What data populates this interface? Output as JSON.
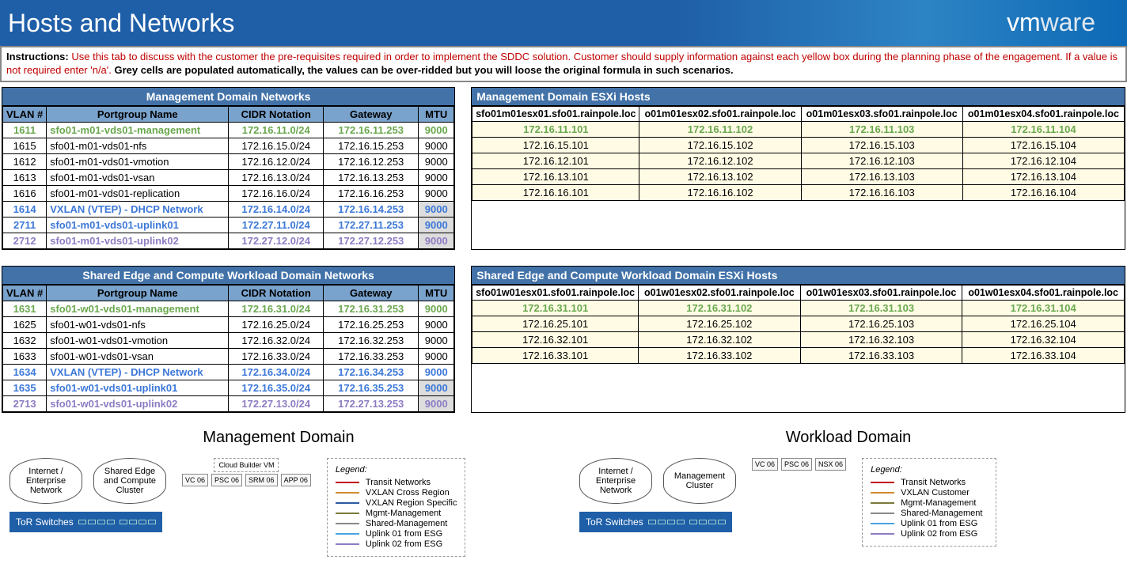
{
  "banner": {
    "title": "Hosts and Networks",
    "logo1": "vm",
    "logo2": "ware"
  },
  "instructions": {
    "label": "Instructions:",
    "red": " Use this tab to discuss with the customer the pre-requisites required in order to implement the SDDC solution. Customer should supply information against each yellow box during the planning phase of the engagement.  If a value is not required enter 'n/a'.  ",
    "black": "Grey cells are populated automatically, the values can be over-ridded but you will loose the original formula in such scenarios."
  },
  "mgmt_net": {
    "title": "Management Domain Networks",
    "headers": [
      "VLAN #",
      "Portgroup Name",
      "CIDR Notation",
      "Gateway",
      "MTU"
    ],
    "rows": [
      {
        "vlan": "1611",
        "pg": "sfo01-m01-vds01-management",
        "cidr": "172.16.11.0/24",
        "gw": "172.16.11.253",
        "mtu": "9000",
        "cls": "gr"
      },
      {
        "vlan": "1615",
        "pg": "sfo01-m01-vds01-nfs",
        "cidr": "172.16.15.0/24",
        "gw": "172.16.15.253",
        "mtu": "9000",
        "cls": ""
      },
      {
        "vlan": "1612",
        "pg": "sfo01-m01-vds01-vmotion",
        "cidr": "172.16.12.0/24",
        "gw": "172.16.12.253",
        "mtu": "9000",
        "cls": ""
      },
      {
        "vlan": "1613",
        "pg": "sfo01-m01-vds01-vsan",
        "cidr": "172.16.13.0/24",
        "gw": "172.16.13.253",
        "mtu": "9000",
        "cls": ""
      },
      {
        "vlan": "1616",
        "pg": "sfo01-m01-vds01-replication",
        "cidr": "172.16.16.0/24",
        "gw": "172.16.16.253",
        "mtu": "9000",
        "cls": ""
      },
      {
        "vlan": "1614",
        "pg": "VXLAN (VTEP) - DHCP Network",
        "cidr": "172.16.14.0/24",
        "gw": "172.16.14.253",
        "mtu": "9000",
        "cls": "bl",
        "greyMtu": true
      },
      {
        "vlan": "2711",
        "pg": "sfo01-m01-vds01-uplink01",
        "cidr": "172.27.11.0/24",
        "gw": "172.27.11.253",
        "mtu": "9000",
        "cls": "bl",
        "greyMtu": true
      },
      {
        "vlan": "2712",
        "pg": "sfo01-m01-vds01-uplink02",
        "cidr": "172.27.12.0/24",
        "gw": "172.27.12.253",
        "mtu": "9000",
        "cls": "pu",
        "greyMtu": true
      }
    ]
  },
  "mgmt_hosts": {
    "title": "Management Domain ESXi Hosts",
    "headers": [
      "sfo01m01esx01.sfo01.rainpole.loc",
      "o01m01esx02.sfo01.rainpole.loc",
      "o01m01esx03.sfo01.rainpole.loc",
      "o01m01esx04.sfo01.rainpole.loc"
    ],
    "rows": [
      {
        "cells": [
          "172.16.11.101",
          "172.16.11.102",
          "172.16.11.103",
          "172.16.11.104"
        ],
        "cls": "gr",
        "yellow": true
      },
      {
        "cells": [
          "172.16.15.101",
          "172.16.15.102",
          "172.16.15.103",
          "172.16.15.104"
        ],
        "cls": "",
        "yellow": true
      },
      {
        "cells": [
          "172.16.12.101",
          "172.16.12.102",
          "172.16.12.103",
          "172.16.12.104"
        ],
        "cls": "",
        "yellow": true
      },
      {
        "cells": [
          "172.16.13.101",
          "172.16.13.102",
          "172.16.13.103",
          "172.16.13.104"
        ],
        "cls": "",
        "yellow": true
      },
      {
        "cells": [
          "172.16.16.101",
          "172.16.16.102",
          "172.16.16.103",
          "172.16.16.104"
        ],
        "cls": "",
        "yellow": true
      }
    ]
  },
  "wl_net": {
    "title": "Shared Edge and Compute Workload Domain Networks",
    "headers": [
      "VLAN #",
      "Portgroup Name",
      "CIDR Notation",
      "Gateway",
      "MTU"
    ],
    "rows": [
      {
        "vlan": "1631",
        "pg": "sfo01-w01-vds01-management",
        "cidr": "172.16.31.0/24",
        "gw": "172.16.31.253",
        "mtu": "9000",
        "cls": "gr"
      },
      {
        "vlan": "1625",
        "pg": "sfo01-w01-vds01-nfs",
        "cidr": "172.16.25.0/24",
        "gw": "172.16.25.253",
        "mtu": "9000",
        "cls": ""
      },
      {
        "vlan": "1632",
        "pg": "sfo01-w01-vds01-vmotion",
        "cidr": "172.16.32.0/24",
        "gw": "172.16.32.253",
        "mtu": "9000",
        "cls": ""
      },
      {
        "vlan": "1633",
        "pg": "sfo01-w01-vds01-vsan",
        "cidr": "172.16.33.0/24",
        "gw": "172.16.33.253",
        "mtu": "9000",
        "cls": ""
      },
      {
        "vlan": "1634",
        "pg": "VXLAN (VTEP) - DHCP Network",
        "cidr": "172.16.34.0/24",
        "gw": "172.16.34.253",
        "mtu": "9000",
        "cls": "bl"
      },
      {
        "vlan": "1635",
        "pg": "sfo01-w01-vds01-uplink01",
        "cidr": "172.16.35.0/24",
        "gw": "172.16.35.253",
        "mtu": "9000",
        "cls": "bl",
        "greyMtu": true
      },
      {
        "vlan": "2713",
        "pg": "sfo01-w01-vds01-uplink02",
        "cidr": "172.27.13.0/24",
        "gw": "172.27.13.253",
        "mtu": "9000",
        "cls": "pu",
        "greyMtu": true
      }
    ]
  },
  "wl_hosts": {
    "title": "Shared Edge and Compute Workload Domain ESXi Hosts",
    "headers": [
      "sfo01w01esx01.sfo01.rainpole.loc",
      "o01w01esx02.sfo01.rainpole.loc",
      "o01w01esx03.sfo01.rainpole.loc",
      "o01w01esx04.sfo01.rainpole.loc"
    ],
    "rows": [
      {
        "cells": [
          "172.16.31.101",
          "172.16.31.102",
          "172.16.31.103",
          "172.16.31.104"
        ],
        "cls": "gr",
        "yellow": true
      },
      {
        "cells": [
          "172.16.25.101",
          "172.16.25.102",
          "172.16.25.103",
          "172.16.25.104"
        ],
        "cls": "",
        "yellow": true
      },
      {
        "cells": [
          "172.16.32.101",
          "172.16.32.102",
          "172.16.32.103",
          "172.16.32.104"
        ],
        "cls": "",
        "yellow": true
      },
      {
        "cells": [
          "172.16.33.101",
          "172.16.33.102",
          "172.16.33.103",
          "172.16.33.104"
        ],
        "cls": "",
        "yellow": true
      }
    ]
  },
  "diag": {
    "mgmt": {
      "title": "Management Domain",
      "cloud1": "Internet / Enterprise Network",
      "cloud2": "Shared Edge and Compute Cluster",
      "cbvm": "Cloud Builder VM",
      "comps": [
        "VC 06",
        "PSC 06",
        "SRM 06",
        "APP 06"
      ],
      "tor": "ToR Switches",
      "legend_title": "Legend:",
      "legend": [
        {
          "c": "lt-red",
          "t": "Transit Networks"
        },
        {
          "c": "lt-orange",
          "t": "VXLAN Cross Region"
        },
        {
          "c": "lt-blue",
          "t": "VXLAN Region Specific"
        },
        {
          "c": "lt-olive",
          "t": "Mgmt-Management"
        },
        {
          "c": "lt-grey",
          "t": "Shared-Management"
        },
        {
          "c": "lt-sky",
          "t": "Uplink 01 from ESG"
        },
        {
          "c": "lt-pu",
          "t": "Uplink 02 from ESG"
        }
      ]
    },
    "wl": {
      "title": "Workload Domain",
      "cloud1": "Internet / Enterprise Network",
      "cloud2": "Management Cluster",
      "comps": [
        "VC 06",
        "PSC 06",
        "NSX 06"
      ],
      "tor": "ToR Switches",
      "legend_title": "Legend:",
      "legend": [
        {
          "c": "lt-red",
          "t": "Transit Networks"
        },
        {
          "c": "lt-orange",
          "t": "VXLAN Customer"
        },
        {
          "c": "lt-olive",
          "t": "Mgmt-Management"
        },
        {
          "c": "lt-grey",
          "t": "Shared-Management"
        },
        {
          "c": "lt-sky",
          "t": "Uplink 01 from ESG"
        },
        {
          "c": "lt-pu",
          "t": "Uplink 02 from ESG"
        }
      ]
    }
  }
}
